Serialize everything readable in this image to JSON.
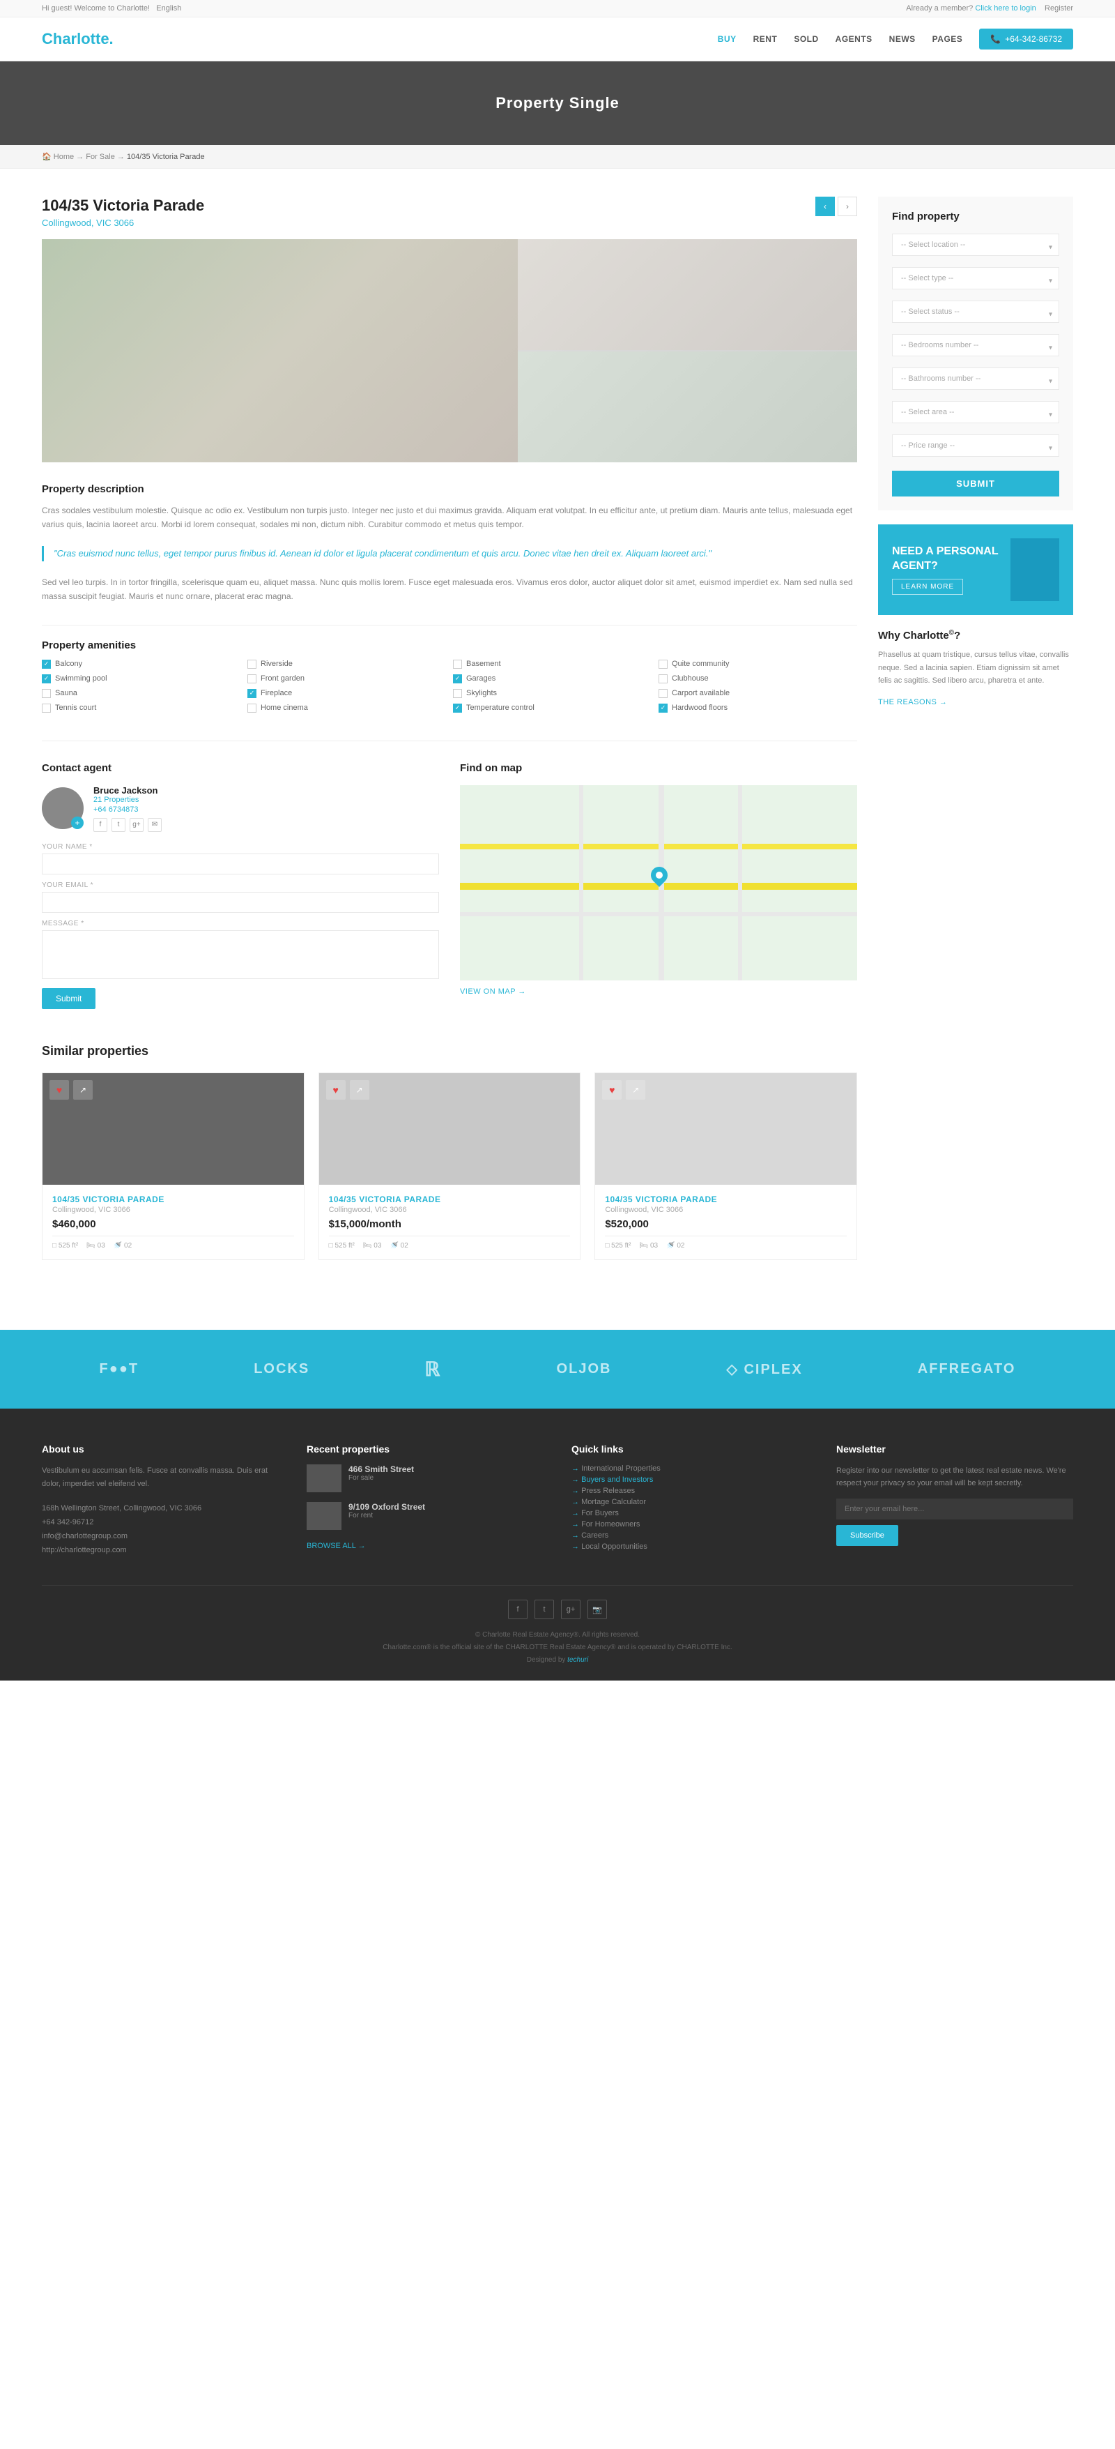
{
  "topBar": {
    "greeting": "Hi guest! Welcome to Charlotte!",
    "language": "English",
    "alreadyMember": "Already a member?",
    "clickToLogin": "Click here to login",
    "register": "Register"
  },
  "header": {
    "logo": "Charlotte.",
    "nav": {
      "buy": "BUY",
      "rent": "RENT",
      "sold": "SOLD",
      "agents": "AGENTS",
      "news": "NEWS",
      "pages": "PAGES"
    },
    "phone": "+64-342-86732"
  },
  "hero": {
    "title": "Property Single"
  },
  "breadcrumb": {
    "home": "Home",
    "forSale": "For Sale",
    "property": "104/35 Victoria Parade"
  },
  "property": {
    "title": "104/35 Victoria Parade",
    "location": "Collingwood, VIC 3066",
    "description1": "Cras sodales vestibulum molestie. Quisque ac odio ex. Vestibulum non turpis justo. Integer nec justo et dui maximus gravida. Aliquam erat volutpat. In eu efficitur ante, ut pretium diam. Mauris ante tellus, malesuada eget varius quis, lacinia laoreet arcu. Morbi id lorem consequat, sodales mi non, dictum nibh. Curabitur commodo et metus quis tempor.",
    "description2": "Sed vel leo turpis. In in tortor fringilla, scelerisque quam eu, aliquet massa. Nunc quis mollis lorem. Fusce eget malesuada eros. Vivamus eros dolor, auctor aliquet dolor sit amet, euismod imperdiet ex. Nam sed nulla sed massa suscipit feugiat. Mauris et nunc ornare, placerat erac magna.",
    "quote": "\"Cras euismod nunc tellus, eget tempor purus finibus id. Aenean id dolor et ligula placerat condimentum et quis arcu. Donec vitae hen dreit ex. Aliquam laoreet arci.\"",
    "amenitiesTitle": "Property amenities",
    "amenities": [
      {
        "label": "Balcony",
        "checked": true
      },
      {
        "label": "Riverside",
        "checked": false
      },
      {
        "label": "Basement",
        "checked": false
      },
      {
        "label": "Quite community",
        "checked": false
      },
      {
        "label": "Swimming pool",
        "checked": true
      },
      {
        "label": "Front garden",
        "checked": false
      },
      {
        "label": "Garages",
        "checked": true
      },
      {
        "label": "Clubhouse",
        "checked": false
      },
      {
        "label": "Sauna",
        "checked": false
      },
      {
        "label": "Fireplace",
        "checked": true
      },
      {
        "label": "Skylights",
        "checked": false
      },
      {
        "label": "Carport available",
        "checked": false
      },
      {
        "label": "Tennis court",
        "checked": false
      },
      {
        "label": "Home cinema",
        "checked": false
      },
      {
        "label": "Temperature control",
        "checked": true
      },
      {
        "label": "Hardwood floors",
        "checked": true
      }
    ]
  },
  "contactAgent": {
    "title": "Contact agent",
    "agent": {
      "name": "Bruce Jackson",
      "properties": "21 Properties",
      "phone": "+64 6734873"
    },
    "form": {
      "namePlaceholder": "YOUR NAME *",
      "emailPlaceholder": "YOUR EMAIL *",
      "messagePlaceholder": "MESSAGE *",
      "submitLabel": "Submit"
    }
  },
  "map": {
    "title": "Find on map",
    "viewOnMap": "VIEW ON MAP →"
  },
  "sidebar": {
    "findProperty": {
      "title": "Find property",
      "locationPlaceholder": "-- Select location --",
      "typePlaceholder": "-- Select type --",
      "statusPlaceholder": "-- Select status --",
      "bedroomsPlaceholder": "-- Bedrooms number --",
      "bathroomsPlaceholder": "-- Bathrooms number --",
      "areaPlaceholder": "-- Select area --",
      "pricePlaceholder": "-- Price range --",
      "submitLabel": "SUBMIT"
    },
    "agentBox": {
      "needText": "NEED A PERSONAL AGENT?",
      "learnMore": "LEARN MORE"
    },
    "whyCharlotte": {
      "title": "Why Charlotte",
      "superscript": "©",
      "suffix": "?",
      "text": "Phasellus at quam tristique, cursus tellus vitae, convallis neque. Sed a lacinia sapien. Etiam dignissim sit amet felis ac sagittis. Sed libero arcu, pharetra et ante.",
      "reasonsLink": "THE REASONS →"
    }
  },
  "similarProperties": {
    "title": "Similar properties",
    "properties": [
      {
        "title": "104/35 VICTORIA PARADE",
        "location": "Collingwood, VIC 3066",
        "price": "$460,000",
        "size": "525 ft²",
        "beds": "03",
        "baths": "02"
      },
      {
        "title": "104/35 VICTORIA PARADE",
        "location": "Collingwood, VIC 3066",
        "price": "$15,000/month",
        "size": "525 ft²",
        "beds": "03",
        "baths": "02"
      },
      {
        "title": "104/35 VICTORIA PARADE",
        "location": "Collingwood, VIC 3066",
        "price": "$520,000",
        "size": "525 ft²",
        "beds": "03",
        "baths": "02"
      }
    ]
  },
  "brands": [
    "FOOT",
    "LOCKS",
    "R",
    "OLJOB",
    "CIPLEX",
    "Affregato"
  ],
  "footer": {
    "aboutUs": {
      "title": "About us",
      "text": "Vestibulum eu accumsan felis. Fusce at convallis massa. Duis erat dolor, imperdiet vel eleifend vel.",
      "address": "168h Wellington Street, Collingwood, VIC 3066",
      "phone": "+64 342-96712",
      "email": "info@charlottegroup.com",
      "website": "http://charlottegroup.com"
    },
    "recentProperties": {
      "title": "Recent properties",
      "properties": [
        {
          "title": "466 Smith Street",
          "status": "For sale"
        },
        {
          "title": "9/109 Oxford Street",
          "status": "For rent"
        }
      ],
      "browseAll": "BROWSE ALL →"
    },
    "quickLinks": {
      "title": "Quick links",
      "links": [
        {
          "label": "International Properties",
          "highlight": false
        },
        {
          "label": "Buyers and Investors",
          "highlight": true
        },
        {
          "label": "Press Releases",
          "highlight": false
        },
        {
          "label": "Mortage Calculator",
          "highlight": false
        },
        {
          "label": "For Buyers",
          "highlight": false
        },
        {
          "label": "For Homeowners",
          "highlight": false
        },
        {
          "label": "Careers",
          "highlight": false
        },
        {
          "label": "Local Opportunities",
          "highlight": false
        }
      ]
    },
    "newsletter": {
      "title": "Newsletter",
      "text": "Register into our newsletter to get the latest real estate news. We're respect your privacy so your email will be kept secretly.",
      "placeholder": "Enter your email here...",
      "subscribeLabel": "Subscribe"
    },
    "bottom": {
      "copyright": "© Charlotte Real Estate Agency®. All rights reserved.",
      "subtext": "Charlotte.com® is the official site of the CHARLOTTE Real Estate Agency® and is operated by CHARLOTTE Inc.",
      "designed": "Designed by",
      "designer": "techuri"
    }
  }
}
